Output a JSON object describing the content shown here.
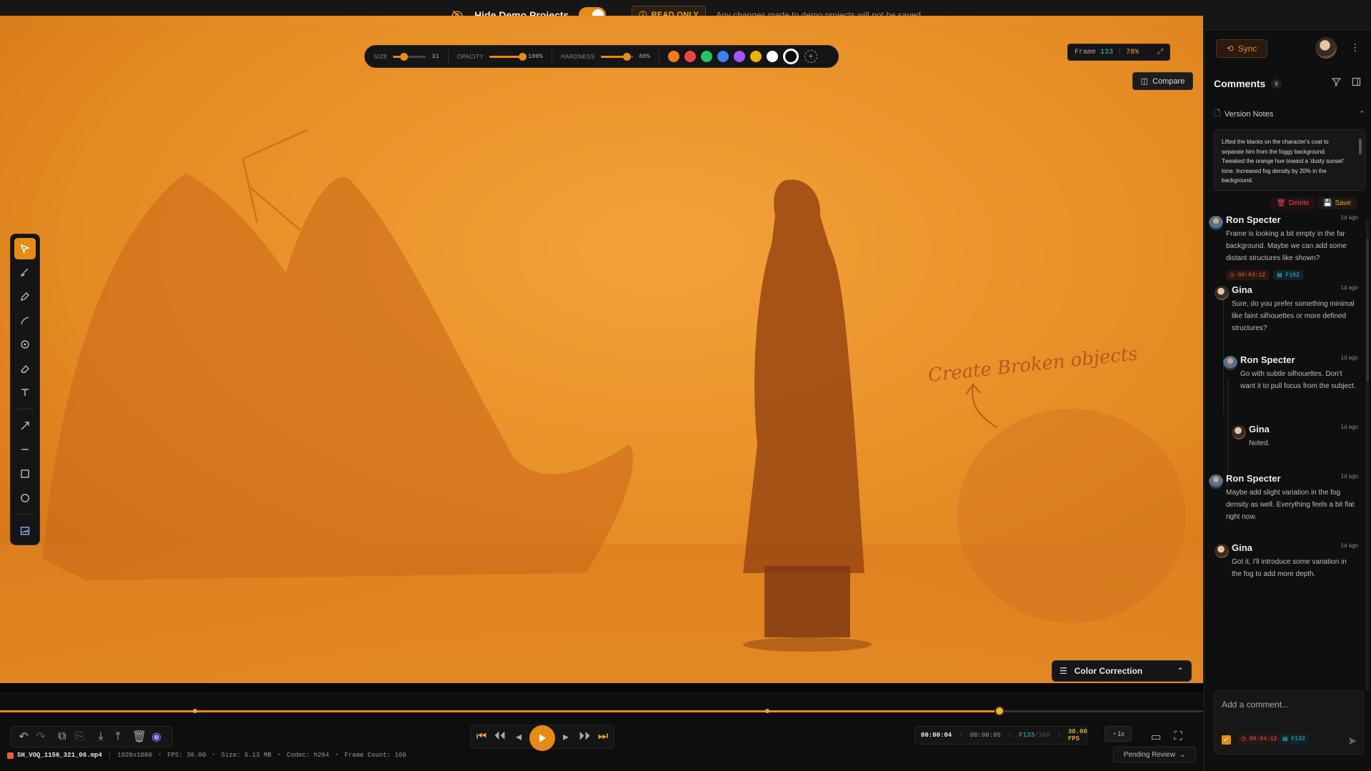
{
  "banner": {
    "hide_label": "Hide Demo Projects",
    "read_only": "READ ONLY",
    "note": "Any changes made to demo projects will not be saved"
  },
  "brush": {
    "size_label": "SIZE",
    "size_value": "31",
    "size_level": 0.31,
    "opacity_label": "OPACITY",
    "opacity_value": "100%",
    "opacity_level": 1.0,
    "hardness_label": "HARDNESS",
    "hardness_value": "80%",
    "hardness_level": 0.8,
    "colors": [
      "#f27a1a",
      "#ef4444",
      "#22c55e",
      "#3b82f6",
      "#a855f7",
      "#eab308",
      "#ffffff",
      "#000000"
    ],
    "selected_color": "#000000"
  },
  "frame_badge": {
    "label": "Frame",
    "number": "133",
    "zoom": "78%"
  },
  "compare_label": "Compare",
  "annotation_text": "Create Broken objects",
  "tools": [
    "cursor-icon",
    "brush-icon",
    "pen-icon",
    "curve-icon",
    "marker-icon",
    "eraser-icon",
    "text-icon",
    "arrow-icon",
    "line-icon",
    "rectangle-icon",
    "ellipse-icon",
    "image-icon"
  ],
  "color_correction_label": "Color Correction",
  "timeline": {
    "progress": 0.831,
    "markers": [
      0.162,
      0.638
    ]
  },
  "playback": {
    "current_time": "00:00:04",
    "duration": "00:00:05",
    "frame": "F133",
    "frame_total": "/160",
    "fps": "30.00 FPS",
    "speed": "1x"
  },
  "status": {
    "file": "SH_VOQ_1156_321_06.mp4",
    "resolution": "1920x1080",
    "fps": "FPS: 30.00",
    "size": "Size: 5.13 MB",
    "codec": "Codec: h264",
    "frame_count": "Frame Count: 160"
  },
  "review_status": "Pending Review",
  "panel": {
    "sync_label": "Sync",
    "comments_title": "Comments",
    "comments_count": "6",
    "version_notes_title": "Version Notes",
    "version_notes_text": "Lifted the blacks on the character's coat to separate him from the foggy background. Tweaked the orange hue toward a 'dusty sunset' tone. Increased fog density by 20% in the background.",
    "delete_label": "Delete",
    "save_label": "Save",
    "add_placeholder": "Add a comment...",
    "add_time_tag": "00:04:13",
    "add_frame_tag": "F133"
  },
  "comments": [
    {
      "author": "Ron Specter",
      "ago": "1d ago",
      "text": "Frame is looking a bit empty in the far background. Maybe we can add some distant structures like shown?",
      "time_tag": "00:03:12",
      "frame_tag": "F102"
    },
    {
      "author": "Gina",
      "ago": "1d ago",
      "text": "Sure, do you prefer something minimal like faint silhouettes or more defined structures?"
    },
    {
      "author": "Ron Specter",
      "ago": "1d ago",
      "text": "Go with subtle silhouettes. Don't want it to pull focus from the subject."
    },
    {
      "author": "Gina",
      "ago": "1d ago",
      "text": "Noted."
    },
    {
      "author": "Ron Specter",
      "ago": "1d ago",
      "text": "Maybe add slight variation in the fog density as well. Everything feels a bit flat right now."
    },
    {
      "author": "Gina",
      "ago": "1d ago",
      "text": "Got it, I'll introduce some variation in the fog to add more depth."
    }
  ]
}
